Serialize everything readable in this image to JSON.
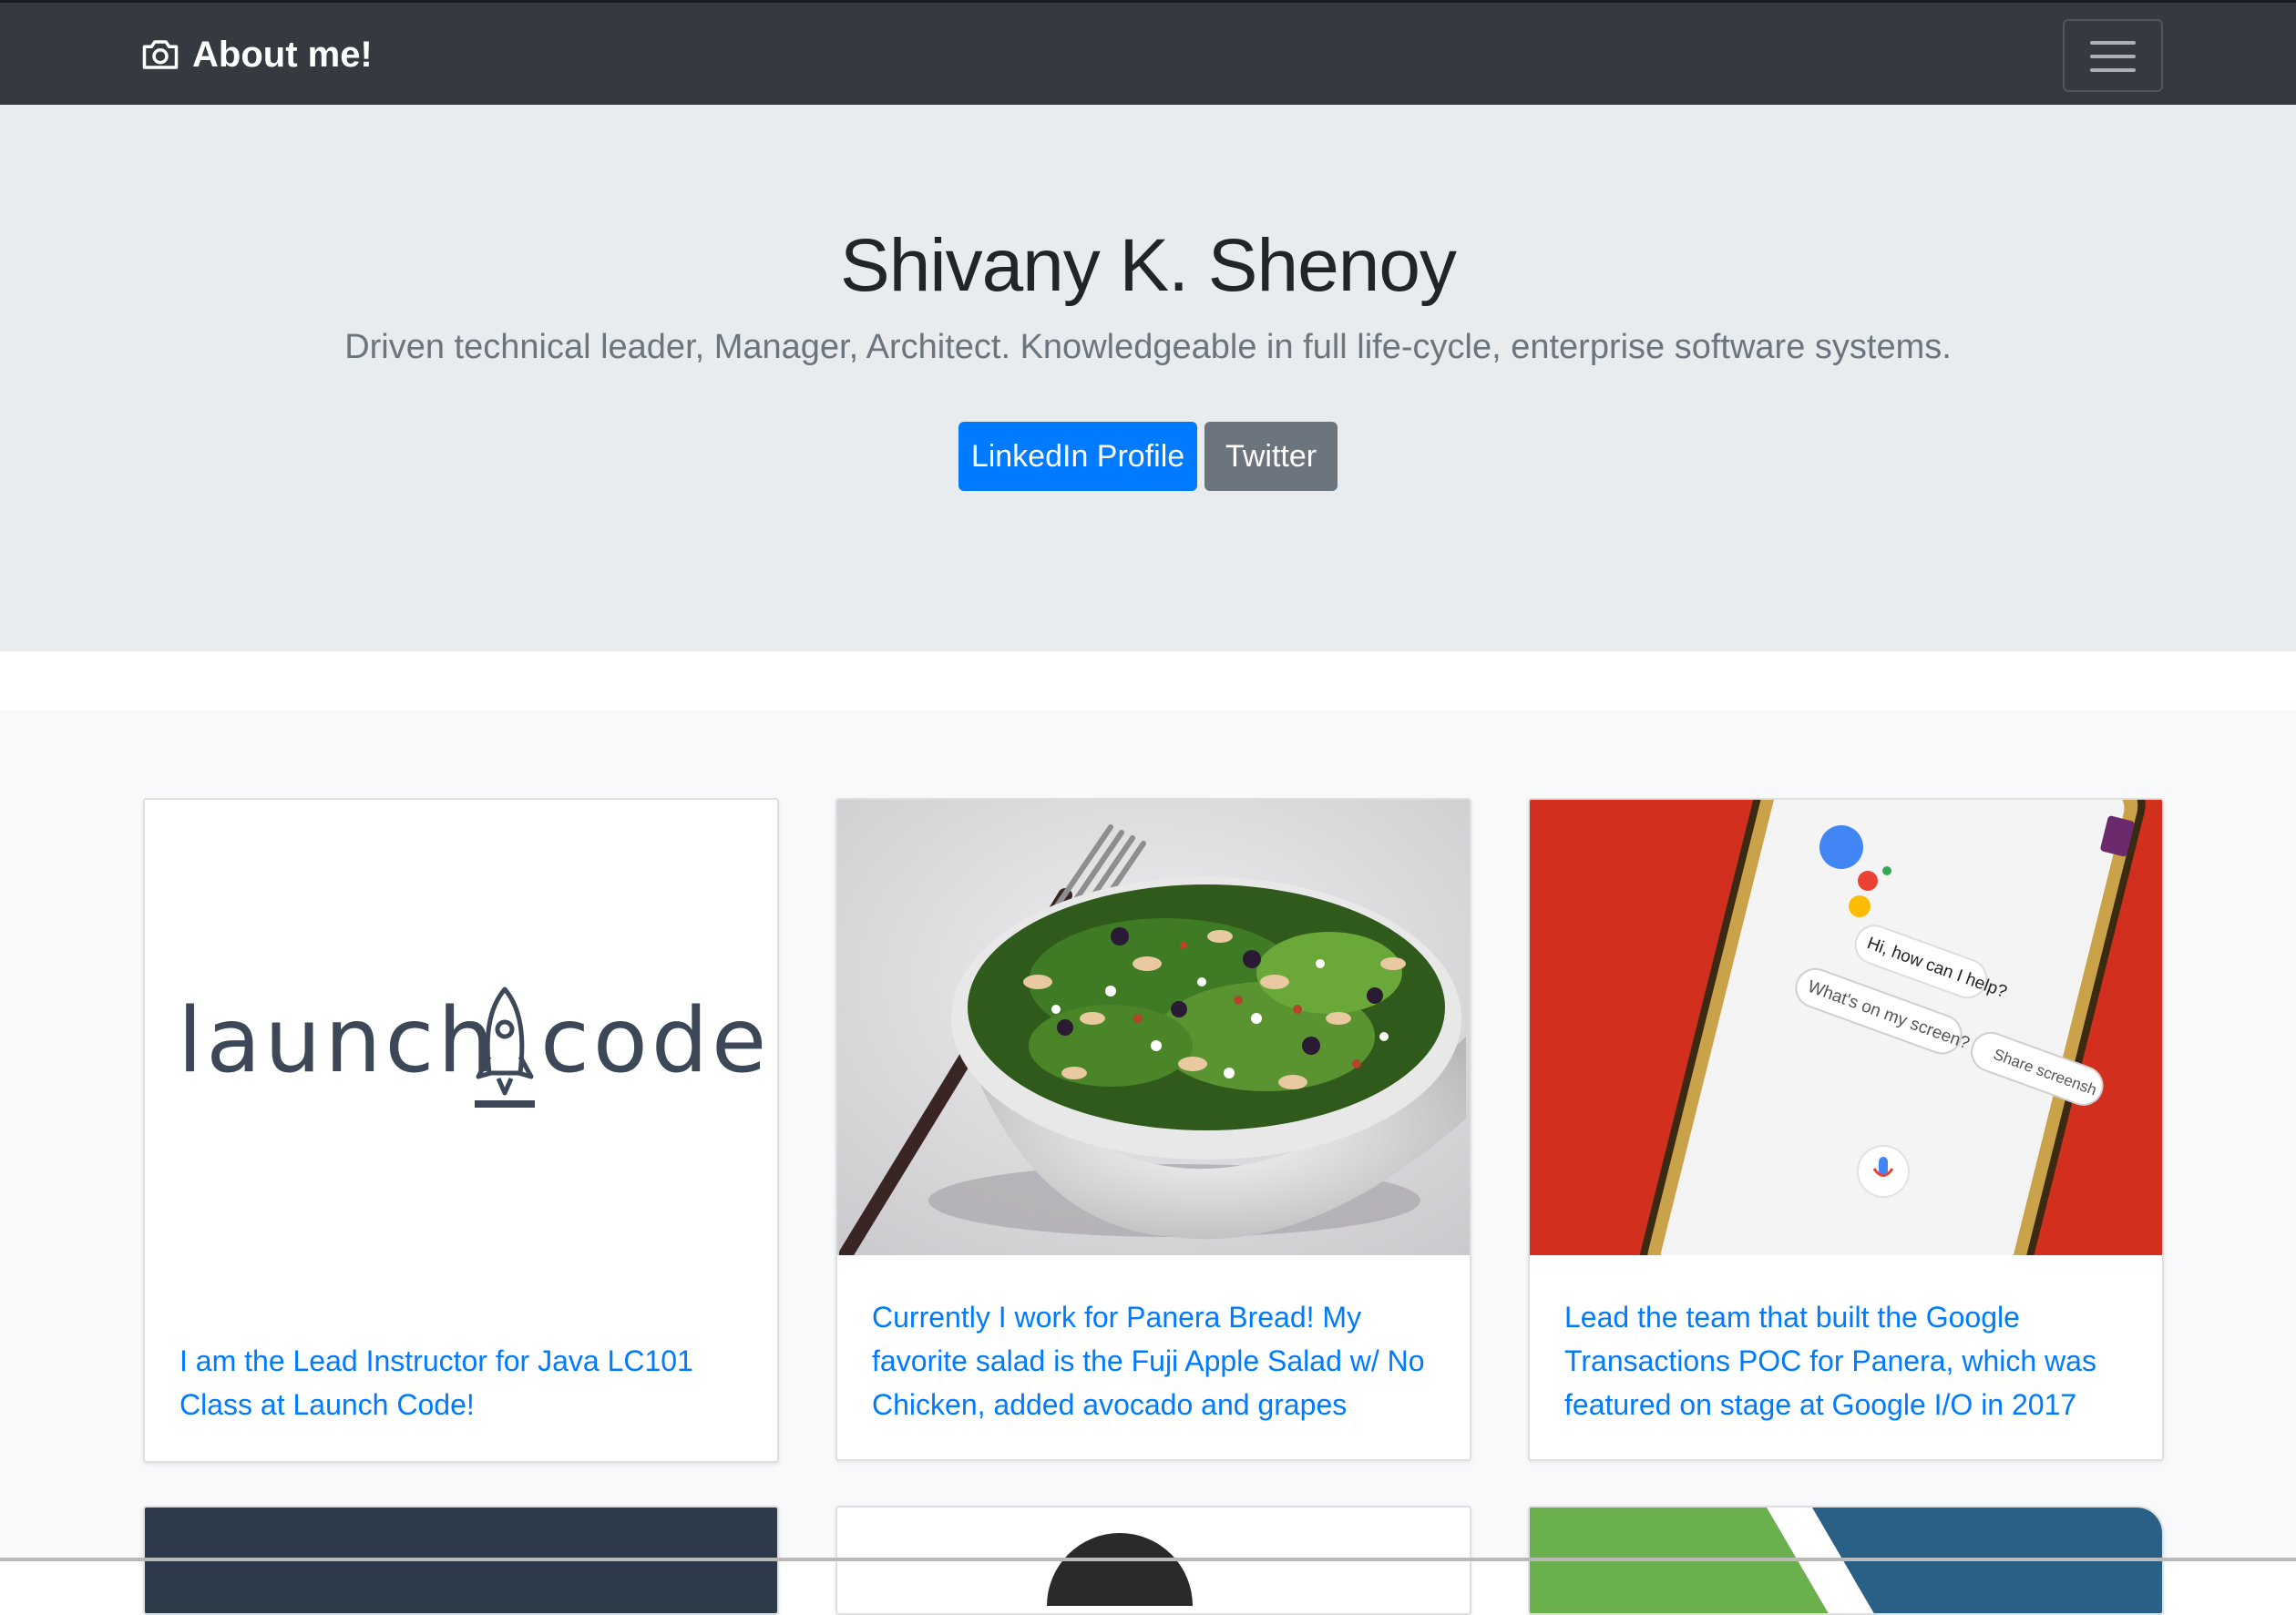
{
  "navbar": {
    "brand_icon": "camera-icon",
    "brand": "About me!",
    "toggler_icon": "hamburger-icon"
  },
  "hero": {
    "name": "Shivany K. Shenoy",
    "tagline": "Driven technical leader, Manager, Architect. Knowledgeable in full life-cycle, enterprise software systems.",
    "buttons": {
      "linkedin": "LinkedIn Profile",
      "twitter": "Twitter"
    }
  },
  "cards": [
    {
      "image": "launchcode-logo",
      "logo_words": [
        "launch",
        "code"
      ],
      "text": "I am the Lead Instructor for Java LC101 Class at Launch Code!"
    },
    {
      "image": "salad-bowl-photo",
      "text": "Currently I work for Panera Bread! My favorite salad is the Fuji Apple Salad w/ No Chicken, added avocado and grapes"
    },
    {
      "image": "google-assistant-phone-photo",
      "phone_texts": [
        "Hi, how can I help?",
        "What's on my screen?",
        "Share screensh"
      ],
      "text": "Lead the team that built the Google Transactions POC for Panera, which was featured on stage at Google I/O in 2017"
    }
  ],
  "colors": {
    "navbar": "#343a40",
    "jumbotron": "#e9ecef",
    "primary": "#007bff",
    "secondary": "#6c757d",
    "album_bg": "#f8f9fa"
  }
}
